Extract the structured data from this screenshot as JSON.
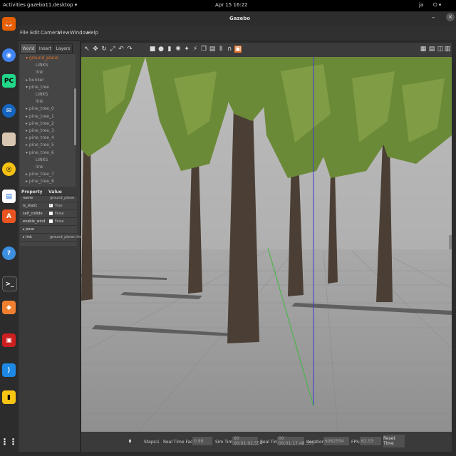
{
  "topbar": {
    "activities": "Activities",
    "app_menu": "gazebo11.desktop ▾",
    "clock": "Apr 15  16:22",
    "user": "ja",
    "sys_icons": "⏻ ▾"
  },
  "window": {
    "title": "Gazebo"
  },
  "menu": {
    "file": "File",
    "edit": "Edit",
    "camera": "Camera",
    "view": "View",
    "window": "Window",
    "help": "Help"
  },
  "left_panel": {
    "tabs": [
      "World",
      "Insert",
      "Layers"
    ],
    "tree": [
      {
        "text": "▾ ground_plane",
        "highlight": true,
        "indent": 0
      },
      {
        "text": "LINKS",
        "indent": 2
      },
      {
        "text": "link",
        "indent": 2
      },
      {
        "text": "▸ bunker",
        "indent": 0
      },
      {
        "text": "▾ pine_tree",
        "indent": 0
      },
      {
        "text": "LINKS",
        "indent": 2
      },
      {
        "text": "link",
        "indent": 2
      },
      {
        "text": "▸ pine_tree_0",
        "indent": 0
      },
      {
        "text": "▸ pine_tree_1",
        "indent": 0
      },
      {
        "text": "▸ pine_tree_2",
        "indent": 0
      },
      {
        "text": "▸ pine_tree_3",
        "indent": 0
      },
      {
        "text": "▸ pine_tree_4",
        "indent": 0
      },
      {
        "text": "▸ pine_tree_5",
        "indent": 0
      },
      {
        "text": "▾ pine_tree_6",
        "indent": 0
      },
      {
        "text": "LINKS",
        "indent": 2
      },
      {
        "text": "link",
        "indent": 2
      },
      {
        "text": "▸ pine_tree_7",
        "indent": 0
      },
      {
        "text": "▸ pine_tree_8",
        "indent": 0
      }
    ],
    "properties": {
      "headers": [
        "Property",
        "Value"
      ],
      "rows": [
        {
          "name": "name",
          "value": "ground_plane"
        },
        {
          "name": "is_static",
          "value": "True",
          "check": "✓"
        },
        {
          "name": "self_collide",
          "value": "False",
          "check": ""
        },
        {
          "name": "enable_wind",
          "value": "False",
          "check": ""
        },
        {
          "name": "▸ pose",
          "value": ""
        },
        {
          "name": "▸ link",
          "value": "ground_plane::link"
        }
      ]
    }
  },
  "bottom": {
    "pause_icon": "pause-icon",
    "steps_label": "Steps:",
    "steps_value": "1",
    "rtf_label": "Real Time Factor:",
    "rtf_value": "0.99",
    "sim_label": "Sim Time:",
    "sim_value": "00 00:01:02.554",
    "real_label": "Real Time:",
    "real_value": "00 00:01:17.48.355",
    "iter_label": "Iterations:",
    "iter_value": "6062554",
    "fps_label": "FPS:",
    "fps_value": "62.53",
    "reset_label": "Reset Time"
  },
  "colors": {
    "ground": "#9e9e9e",
    "sky": "#b6b6b6",
    "trunk": "#4a3d32",
    "foliage": "#6e8a3a",
    "accent": "#e0712a"
  }
}
